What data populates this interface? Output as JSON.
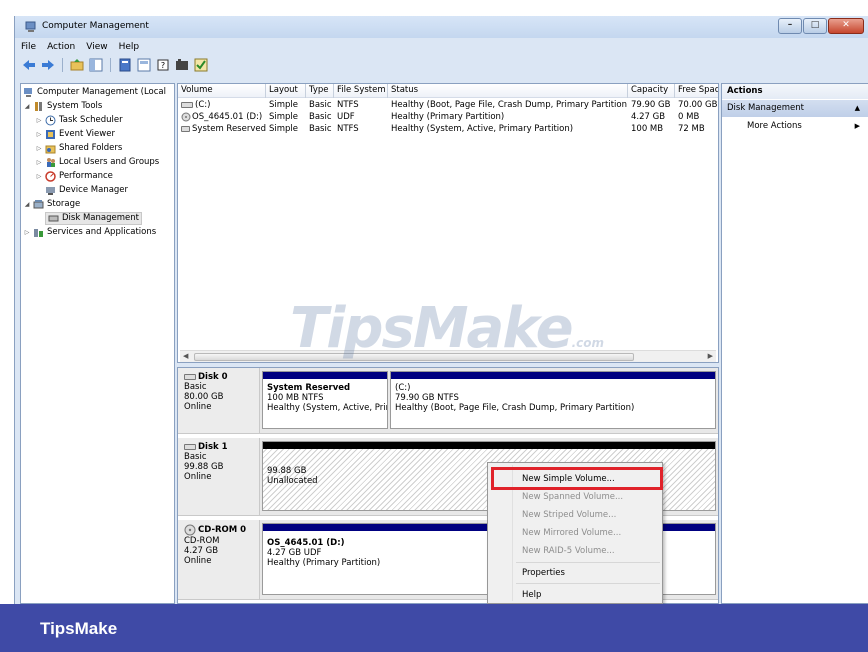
{
  "window": {
    "title": "Computer Management",
    "minimize": "–",
    "maximize": "□",
    "close": "✕"
  },
  "menu": [
    "File",
    "Action",
    "View",
    "Help"
  ],
  "toolbar_icons": [
    "back-icon",
    "forward-icon",
    "up-folder-icon",
    "show-hide-tree-icon",
    "properties-icon",
    "help-icon",
    "export-icon",
    "console-icon"
  ],
  "tree": {
    "root": "Computer Management (Local",
    "system_tools": "System Tools",
    "task_scheduler": "Task Scheduler",
    "event_viewer": "Event Viewer",
    "shared_folders": "Shared Folders",
    "local_users": "Local Users and Groups",
    "performance": "Performance",
    "device_manager": "Device Manager",
    "storage": "Storage",
    "disk_management": "Disk Management",
    "services": "Services and Applications"
  },
  "volumes": {
    "headers": [
      "Volume",
      "Layout",
      "Type",
      "File System",
      "Status",
      "Capacity",
      "Free Spac"
    ],
    "rows": [
      {
        "volume": "(C:)",
        "layout": "Simple",
        "type": "Basic",
        "fs": "NTFS",
        "status": "Healthy (Boot, Page File, Crash Dump, Primary Partition)",
        "capacity": "79.90 GB",
        "free": "70.00 GB"
      },
      {
        "volume": "OS_4645.01 (D:)",
        "layout": "Simple",
        "type": "Basic",
        "fs": "UDF",
        "status": "Healthy (Primary Partition)",
        "capacity": "4.27 GB",
        "free": "0 MB"
      },
      {
        "volume": "System Reserved",
        "layout": "Simple",
        "type": "Basic",
        "fs": "NTFS",
        "status": "Healthy (System, Active, Primary Partition)",
        "capacity": "100 MB",
        "free": "72 MB"
      }
    ]
  },
  "disks": {
    "disk0": {
      "name": "Disk 0",
      "kind": "Basic",
      "size": "80.00 GB",
      "state": "Online",
      "p1": {
        "name": "System Reserved",
        "size": "100 MB NTFS",
        "status": "Healthy (System, Active, Prir"
      },
      "p2": {
        "name": "(C:)",
        "size": "79.90 GB NTFS",
        "status": "Healthy (Boot, Page File, Crash Dump, Primary Partition)"
      }
    },
    "disk1": {
      "name": "Disk 1",
      "kind": "Basic",
      "size": "99.88 GB",
      "state": "Online",
      "p1": {
        "size": "99.88 GB",
        "status": "Unallocated"
      }
    },
    "cdrom0": {
      "name": "CD-ROM 0",
      "kind": "CD-ROM",
      "size": "4.27 GB",
      "state": "Online",
      "p1": {
        "name": "OS_4645.01 (D:)",
        "size": "4.27 GB UDF",
        "status": "Healthy (Primary Partition)"
      }
    }
  },
  "actions": {
    "header": "Actions",
    "section": "Disk Management",
    "more": "More Actions"
  },
  "context_menu": {
    "new_simple": "New Simple Volume...",
    "new_spanned": "New Spanned Volume...",
    "new_striped": "New Striped Volume...",
    "new_mirrored": "New Mirrored Volume...",
    "new_raid5": "New RAID-5 Volume...",
    "properties": "Properties",
    "help": "Help"
  },
  "watermark": {
    "brand": "TipsMake",
    "suffix": ".com"
  },
  "banner": {
    "brand": "TipsMake"
  },
  "colors": {
    "partition_bar": "#000080",
    "unallocated_bar": "#000000",
    "highlight": "#e0222a",
    "banner": "#3f4aa6"
  }
}
